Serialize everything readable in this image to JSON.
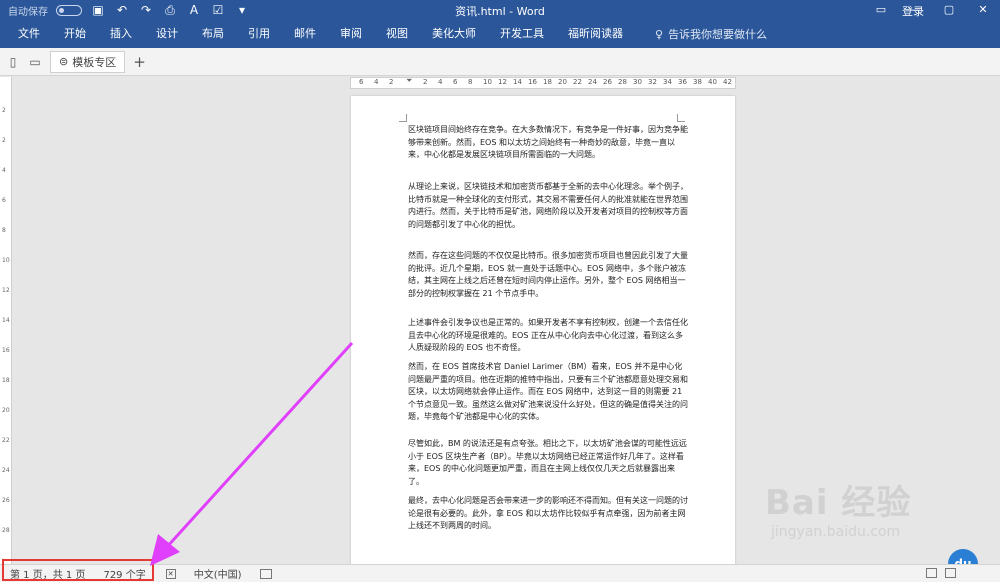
{
  "titlebar": {
    "autosave_label": "自动保存",
    "doc_title": "资讯.html - Word",
    "login": "登录",
    "window_buttons": [
      "▭",
      "—",
      "▢",
      "✕"
    ]
  },
  "ribbon": {
    "tabs": [
      "文件",
      "开始",
      "插入",
      "设计",
      "布局",
      "引用",
      "邮件",
      "审阅",
      "视图",
      "美化大师",
      "开发工具",
      "福昕阅读器"
    ],
    "tell_me": "告诉我你想要做什么"
  },
  "doc_tabs": {
    "active_tab": "模板专区"
  },
  "ruler": {
    "ticks": [
      "6",
      "4",
      "2",
      "",
      "2",
      "4",
      "6",
      "8",
      "10",
      "12",
      "14",
      "16",
      "18",
      "20",
      "22",
      "24",
      "26",
      "28",
      "30",
      "32",
      "34",
      "36",
      "38",
      "40",
      "42"
    ]
  },
  "document": {
    "paragraphs": [
      "区块链项目间始终存在竞争。在大多数情况下，有竞争是一件好事，因为竞争能够带来创新。然而，EOS 和以太坊之间始终有一种奇妙的敌意，毕竟一直以来，中心化都是发展区块链项目所需面临的一大问题。",
      "从理论上来说，区块链技术和加密货币都基于全新的去中心化理念。举个例子，比特币就是一种全球化的支付形式，其交易不需要任何人的批准就能在世界范围内进行。然而，关于比特币是矿池，网络阶段以及开发者对项目的控制权等方面的问题都引发了中心化的担忧。",
      "然而，存在这些问题的不仅仅是比特币。很多加密货币项目也曾因此引发了大量的批评。近几个星期，EOS 就一直处于话题中心。EOS 网络中，多个账户被冻结，其主网在上线之后还曾在短时间内停止运作。另外，整个 EOS 网络相当一部分的控制权掌握在 21 个节点手中。",
      "上述事件会引发争议也是正常的。如果开发者不享有控制权，创建一个去信任化且去中心化的环境是很难的。EOS 正在从中心化向去中心化过渡，看到这么多人质疑现阶段的 EOS 也不奇怪。",
      "然而，在 EOS 首席技术官 Daniel Larimer（BM）看来，EOS 并不是中心化问题最严重的项目。他在近期的推特中指出，只要有三个矿池都愿意处理交易和区块，以太坊网络就会停止运作。而在 EOS 网络中，达到这一目的则需要 21 个节点意见一致。虽然这么做对矿池来说没什么好处，但这的确是值得关注的问题，毕竟每个矿池都是中心化的实体。",
      "尽管如此，BM 的说法还是有点夸张。相比之下，以太坊矿池会谋的可能性远远小于 EOS 区块生产者（BP）。毕竟以太坊网络已经正常运作好几年了。这样看来，EOS 的中心化问题更加严重，而且在主网上线仅仅几天之后就暴露出来了。",
      "最终，去中心化问题是否会带来进一步的影响还不得而知。但有关这一问题的讨论是很有必要的。此外，拿 EOS 和以太坊作比较似乎有点牵强，因为前者主网上线还不到两周的时间。"
    ]
  },
  "statusbar": {
    "page_info": "第 1 页，共 1 页",
    "word_count": "729 个字",
    "language": "中文(中国)"
  },
  "watermark": {
    "main": "Bai 经验",
    "sub": "jingyan.baidu.com",
    "badge": "du"
  },
  "colors": {
    "ribbon_blue": "#2b579a",
    "highlight_red": "#e53935",
    "arrow_magenta": "#e040fb"
  }
}
